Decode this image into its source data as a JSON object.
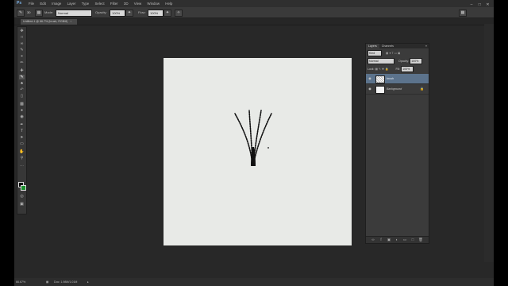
{
  "app": {
    "logo": "Ps",
    "menus": [
      "File",
      "Edit",
      "Image",
      "Layer",
      "Type",
      "Select",
      "Filter",
      "3D",
      "View",
      "Window",
      "Help"
    ]
  },
  "window_controls": [
    "–",
    "□",
    "✕"
  ],
  "options_bar": {
    "brush_size": "30",
    "mode_label": "Mode:",
    "mode_value": "Normal",
    "opacity_label": "Opacity:",
    "opacity_value": "100%",
    "flow_label": "Flow:",
    "flow_value": "100%"
  },
  "document": {
    "tab_title": "Untitled-1 @ 66.7% (brush, RGB/8)",
    "close": "×"
  },
  "layers_panel": {
    "tabs": [
      "Layers",
      "Channels"
    ],
    "kind_value": "Kind",
    "blend_mode": "Normal",
    "opacity_label": "Opacity:",
    "opacity_value": "100%",
    "lock_label": "Lock:",
    "fill_label": "Fill:",
    "fill_value": "100%",
    "layers": [
      {
        "name": "brush",
        "selected": true
      },
      {
        "name": "Background",
        "selected": false
      }
    ],
    "footer_icons": [
      "link-icon",
      "fx-icon",
      "mask-icon",
      "adjustment-icon",
      "group-icon",
      "new-layer-icon",
      "trash-icon"
    ]
  },
  "status": {
    "zoom": "66.67%",
    "doc_info": "Doc: 1.98M/1.01M"
  },
  "colors": {
    "foreground": "#000000",
    "background_swatch": "#1a8f2d",
    "canvas": "#e8eae7",
    "selected_layer": "#5c738c"
  }
}
